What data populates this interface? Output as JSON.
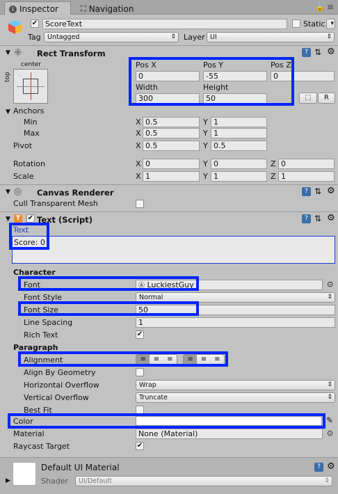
{
  "tabs": [
    {
      "label": "Inspector",
      "icon": "info-icon"
    },
    {
      "label": "Navigation",
      "icon": "navigation-icon"
    }
  ],
  "header": {
    "object_name": "ScoreText",
    "active": true,
    "static_label": "Static",
    "static_checked": false,
    "tag_label": "Tag",
    "tag_value": "Untagged",
    "layer_label": "Layer",
    "layer_value": "UI"
  },
  "rect_transform": {
    "title": "Rect Transform",
    "anchor_preset_top": "center",
    "anchor_preset_side": "top",
    "pos_x_label": "Pos X",
    "pos_x": "0",
    "pos_y_label": "Pos Y",
    "pos_y": "-55",
    "pos_z_label": "Pos Z",
    "pos_z": "0",
    "width_label": "Width",
    "width": "300",
    "height_label": "Height",
    "height": "50",
    "blueprint_btn": "⬚",
    "raw_btn": "R",
    "anchors_label": "Anchors",
    "min_label": "Min",
    "min_x": "0.5",
    "min_y": "1",
    "max_label": "Max",
    "max_x": "0.5",
    "max_y": "1",
    "pivot_label": "Pivot",
    "pivot_x": "0.5",
    "pivot_y": "0.5",
    "rotation_label": "Rotation",
    "rot_x": "0",
    "rot_y": "0",
    "rot_z": "0",
    "scale_label": "Scale",
    "scale_x": "1",
    "scale_y": "1",
    "scale_z": "1",
    "x": "X",
    "y": "Y",
    "z": "Z"
  },
  "canvas_renderer": {
    "title": "Canvas Renderer",
    "cull_label": "Cull Transparent Mesh",
    "cull_checked": false
  },
  "text_script": {
    "title": "Text (Script)",
    "text_label": "Text",
    "text_value": "Score: 0",
    "character_label": "Character",
    "font_label": "Font",
    "font_value": "LuckiestGuy",
    "font_style_label": "Font Style",
    "font_style_value": "Normal",
    "font_size_label": "Font Size",
    "font_size_value": "50",
    "line_spacing_label": "Line Spacing",
    "line_spacing_value": "1",
    "rich_text_label": "Rich Text",
    "rich_text_checked": true,
    "paragraph_label": "Paragraph",
    "alignment_label": "Alignment",
    "align_geometry_label": "Align By Geometry",
    "align_geometry_checked": false,
    "h_overflow_label": "Horizontal Overflow",
    "h_overflow_value": "Wrap",
    "v_overflow_label": "Vertical Overflow",
    "v_overflow_value": "Truncate",
    "best_fit_label": "Best Fit",
    "best_fit_checked": false,
    "color_label": "Color",
    "color_value": "#ffffff",
    "material_label": "Material",
    "material_value": "None (Material)",
    "raycast_label": "Raycast Target",
    "raycast_checked": true
  },
  "material_footer": {
    "name": "Default UI Material",
    "shader_label": "Shader",
    "shader_value": "UI/Default"
  },
  "colors": {
    "highlight": "#0026ff",
    "panel": "#c2c2c2",
    "link_text": "#1c3fd6"
  }
}
